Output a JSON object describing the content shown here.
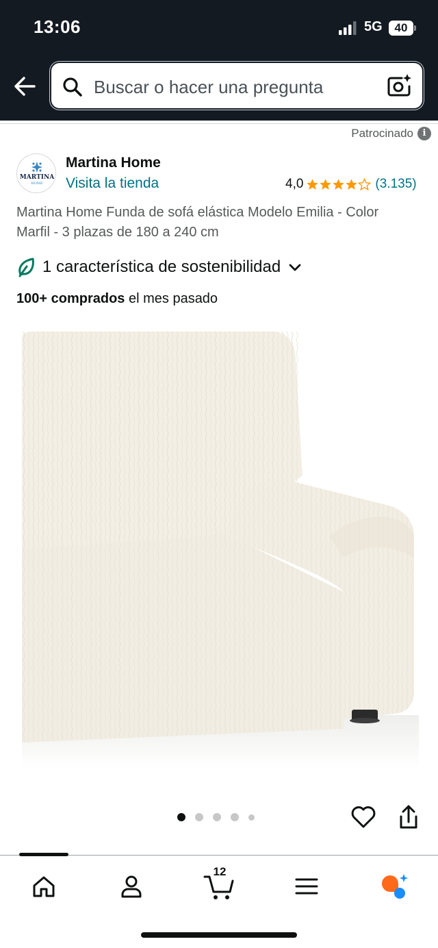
{
  "status_bar": {
    "time": "13:06",
    "network": "5G",
    "battery": "40"
  },
  "search": {
    "placeholder": "Buscar o hacer una pregunta"
  },
  "icons": {
    "back": "arrow-left-icon",
    "search": "search-icon",
    "camera": "camera-lens-icon",
    "info": "info-icon",
    "leaf": "leaf-icon",
    "heart": "heart-icon",
    "share": "share-icon",
    "home": "home-icon",
    "account": "person-icon",
    "cart": "cart-icon",
    "menu": "menu-icon",
    "rufus": "assistant-icon"
  },
  "colors": {
    "header_bg": "#131a22",
    "link": "#007185",
    "star": "#ff9900",
    "sustain": "#007a5e"
  },
  "sponsored": {
    "label": "Patrocinado",
    "info_glyph": "i"
  },
  "brand": {
    "name": "Martina Home",
    "visit_link": "Visita la tienda",
    "logo_text": "MARTINA",
    "logo_subtext": "HOME"
  },
  "rating": {
    "value": "4,0",
    "stars": 4,
    "max_stars": 5,
    "count": "(3.135)"
  },
  "product": {
    "title": "Martina Home Funda de sofá elástica Modelo Emilia - Color Marfil - 3 plazas de 180 a 240 cm",
    "sustainability": "1 característica de sostenibilidad",
    "bought_strong": "100+ comprados",
    "bought_rest": " el mes pasado"
  },
  "gallery": {
    "image_count": 5,
    "current_index": 0
  },
  "bottom_nav": {
    "cart_count": "12"
  }
}
